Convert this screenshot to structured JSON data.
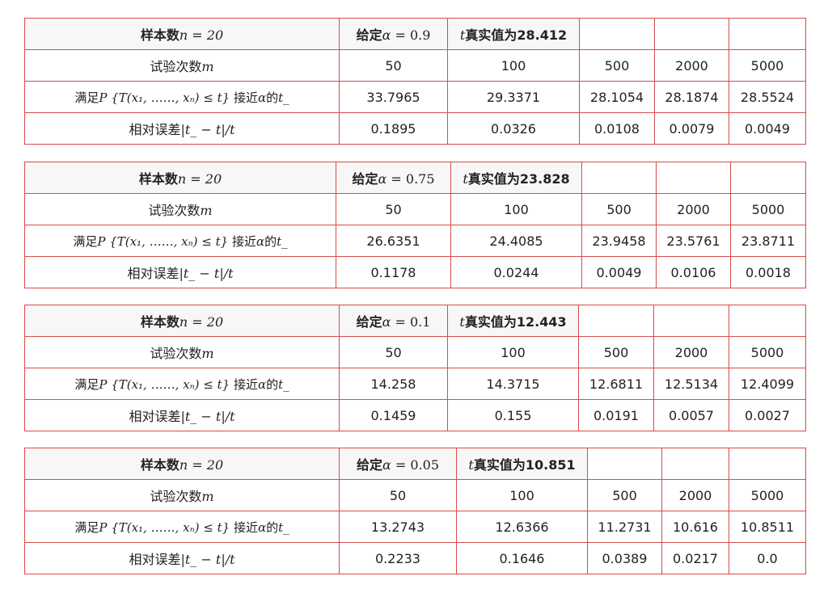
{
  "labels": {
    "sample_prefix": "样本数",
    "sample_math": "n = 20",
    "given_prefix": "给定",
    "alpha_sym": "α = ",
    "true_sym": "t",
    "true_prefix": "真实值为",
    "trials_label": "试验次数",
    "trials_sym": "m",
    "row_t_pre": "满足",
    "row_t_math": "P {T(x₁, ……, xₙ) ≤ t}",
    "row_t_mid": " 接近",
    "row_t_alpha": "α",
    "row_t_post": "的",
    "row_t_sym": "t_",
    "row_err_pre": "相对误差",
    "row_err_math": "|t_ − t|/t"
  },
  "tables": [
    {
      "alpha": "0.9",
      "true_value": "28.412",
      "m": [
        "50",
        "100",
        "500",
        "2000",
        "5000"
      ],
      "t_values": [
        "33.7965",
        "29.3371",
        "28.1054",
        "28.1874",
        "28.5524"
      ],
      "rel_errors": [
        "0.1895",
        "0.0326",
        "0.0108",
        "0.0079",
        "0.0049"
      ]
    },
    {
      "alpha": "0.75",
      "true_value": "23.828",
      "m": [
        "50",
        "100",
        "500",
        "2000",
        "5000"
      ],
      "t_values": [
        "26.6351",
        "24.4085",
        "23.9458",
        "23.5761",
        "23.8711"
      ],
      "rel_errors": [
        "0.1178",
        "0.0244",
        "0.0049",
        "0.0106",
        "0.0018"
      ]
    },
    {
      "alpha": "0.1",
      "true_value": "12.443",
      "m": [
        "50",
        "100",
        "500",
        "2000",
        "5000"
      ],
      "t_values": [
        "14.258",
        "14.3715",
        "12.6811",
        "12.5134",
        "12.4099"
      ],
      "rel_errors": [
        "0.1459",
        "0.155",
        "0.0191",
        "0.0057",
        "0.0027"
      ]
    },
    {
      "alpha": "0.05",
      "true_value": "10.851",
      "m": [
        "50",
        "100",
        "500",
        "2000",
        "5000"
      ],
      "t_values": [
        "13.2743",
        "12.6366",
        "11.2731",
        "10.616",
        "10.8511"
      ],
      "rel_errors": [
        "0.2233",
        "0.1646",
        "0.0389",
        "0.0217",
        "0.0"
      ]
    }
  ]
}
